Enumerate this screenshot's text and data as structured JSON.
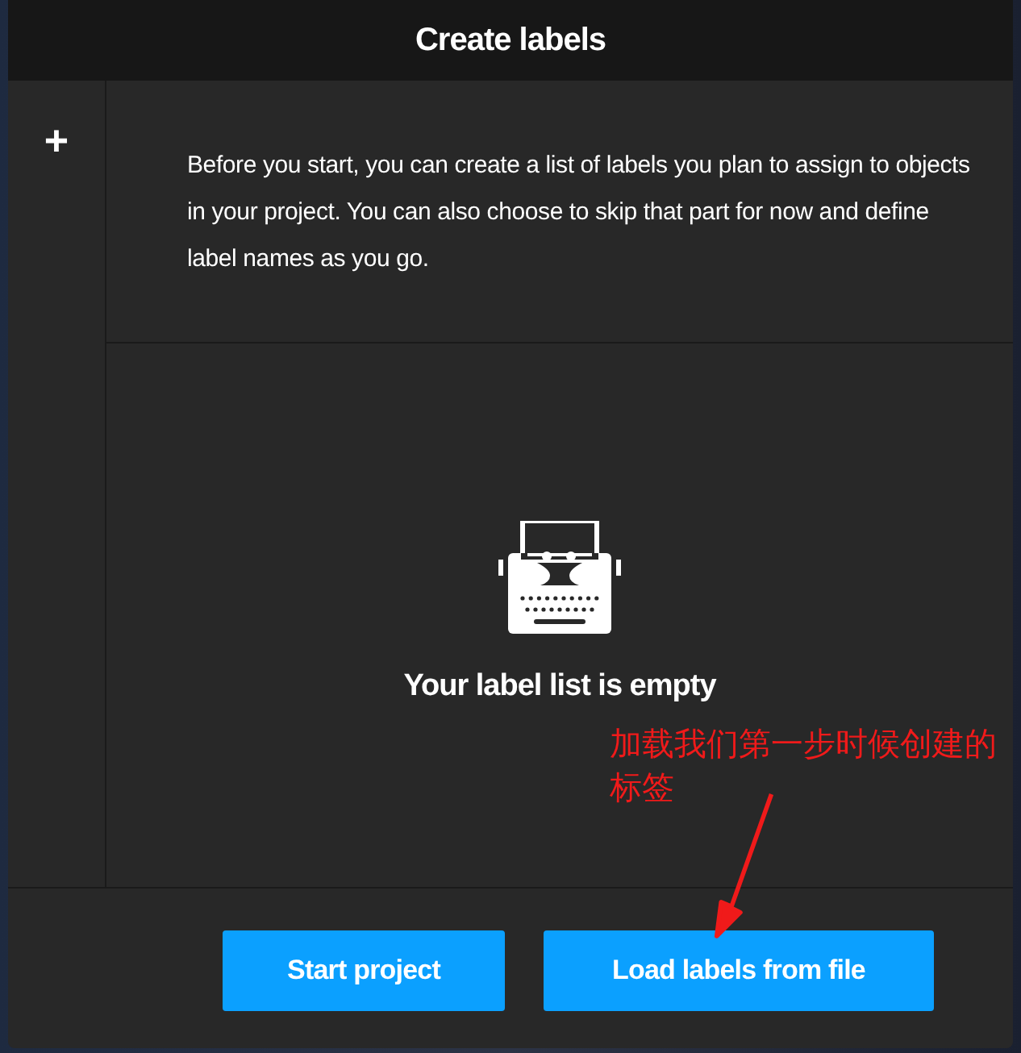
{
  "window": {
    "title": "Create labels"
  },
  "sidebar": {
    "add_button": "+"
  },
  "description": "Before you start, you can create a list of labels you plan to assign to objects in your project. You can also choose to skip that part for now and define label names as you go.",
  "empty_state": {
    "message": "Your label list is empty"
  },
  "annotation": {
    "text": "加载我们第一步时候创建的标签"
  },
  "buttons": [
    {
      "label": "Start project"
    },
    {
      "label": "Load labels from file"
    }
  ]
}
